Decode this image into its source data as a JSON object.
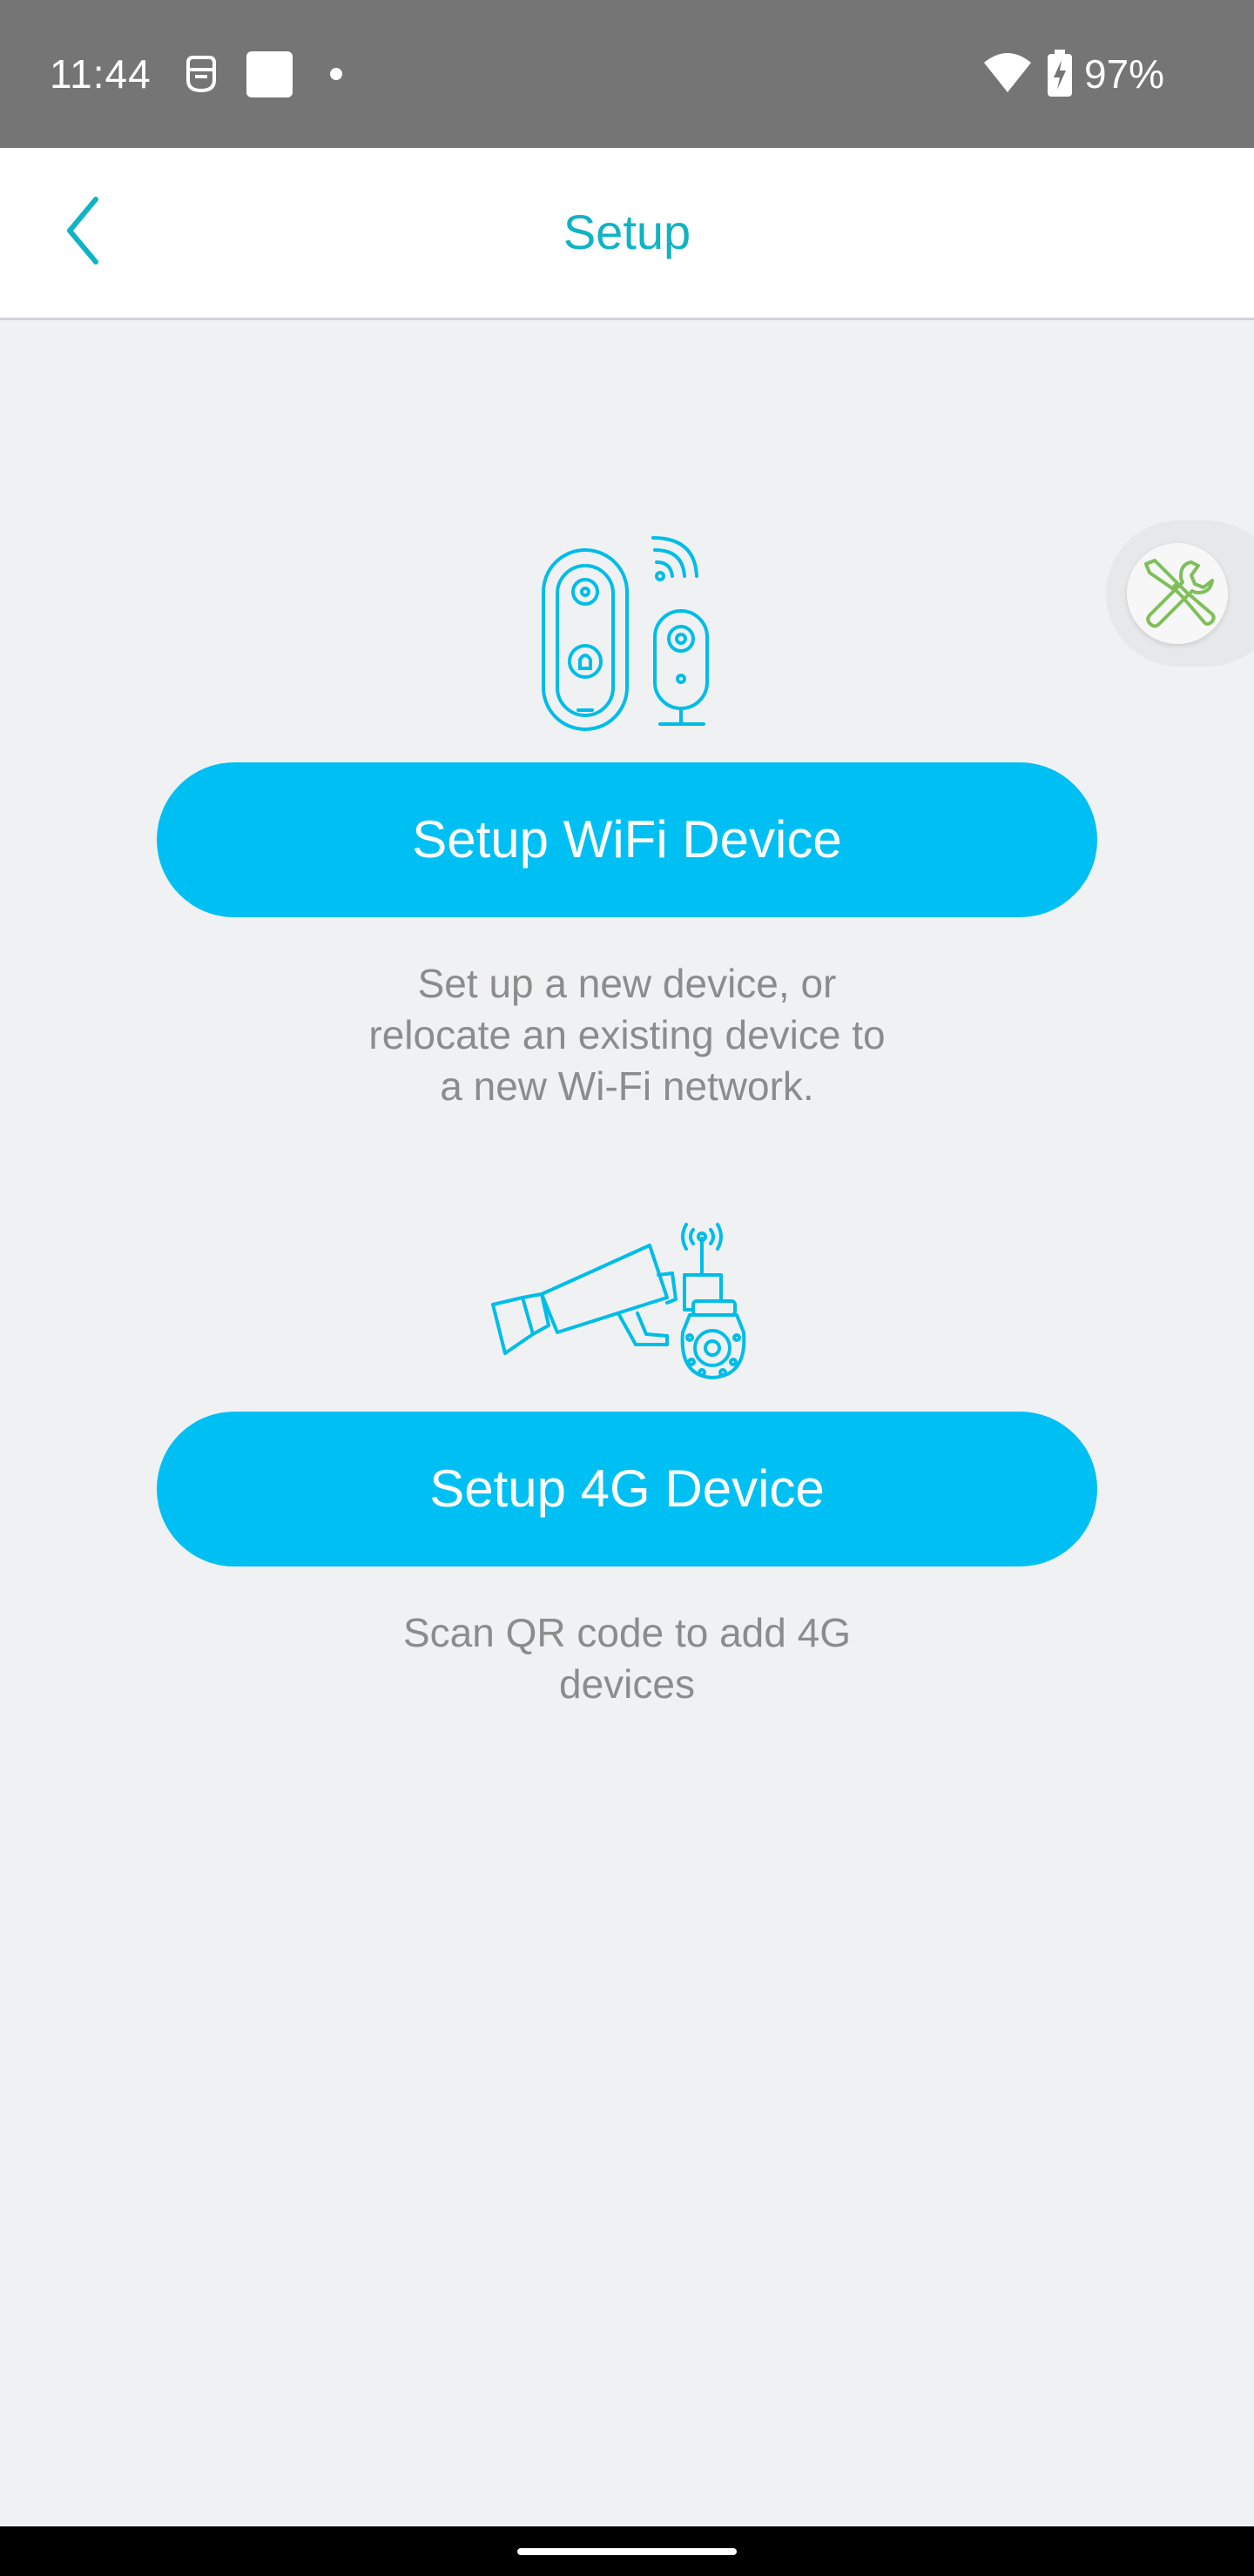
{
  "status_bar": {
    "time": "11:44",
    "battery_percent": "97%",
    "icons": [
      "face-icon",
      "square-icon",
      "dot-icon",
      "wifi-icon",
      "battery-charging-icon"
    ],
    "background_color": "#757575"
  },
  "header": {
    "title": "Setup",
    "back_icon": "chevron-left-icon",
    "accent_color": "#10b3c4"
  },
  "floating_tool": {
    "icon": "tools-icon"
  },
  "wifi_section": {
    "illustration": "wifi-devices-illustration",
    "button_label": "Setup WiFi Device",
    "description": [
      "Set up a new device, or",
      "relocate an existing device to",
      "a new Wi-Fi network."
    ]
  },
  "g4_section": {
    "illustration": "4g-cameras-illustration",
    "button_label": "Setup 4G Device",
    "description": [
      "Scan QR code to add 4G",
      "devices"
    ]
  },
  "colors": {
    "button": "#00c0f3",
    "background": "#f0f1f3",
    "description_text": "#8c8c8c"
  }
}
